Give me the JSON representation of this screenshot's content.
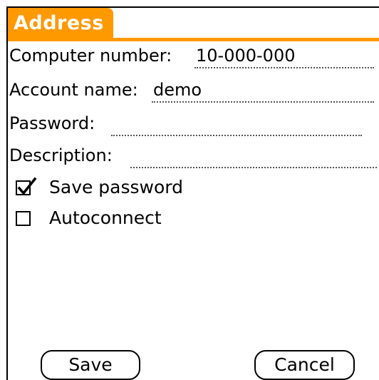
{
  "form": {
    "title": "Address",
    "fields": [
      {
        "label": "Computer number:",
        "value": "10-000-000"
      },
      {
        "label": "Account name:",
        "value": "demo"
      },
      {
        "label": "Password:",
        "value": ""
      },
      {
        "label": "Description:",
        "value": ""
      }
    ],
    "checkboxes": [
      {
        "label": "Save password",
        "checked": true
      },
      {
        "label": "Autoconnect",
        "checked": false
      }
    ],
    "buttons": {
      "save_label": "Save",
      "cancel_label": "Cancel"
    }
  },
  "colors": {
    "accent": "#ff9900",
    "title_text": "#ffffff",
    "foreground": "#000000",
    "background": "#ffffff"
  },
  "icons": {
    "checked": "checkbox-checked-icon",
    "unchecked": "checkbox-unchecked-icon"
  }
}
